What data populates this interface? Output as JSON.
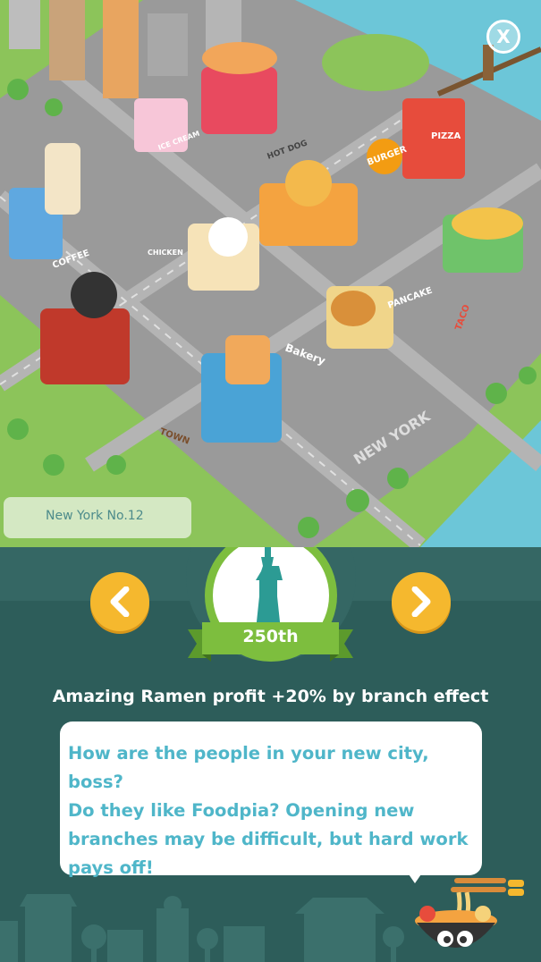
{
  "close_button": {
    "label": "X"
  },
  "city": {
    "name": "New York No.12"
  },
  "map_signs": {
    "ice_cream": "ICE CREAM",
    "hot_dog": "HOT DOG",
    "burger": "BURGER",
    "pizza": "PIZZA",
    "coffee": "COFFEE",
    "chicken": "CHICKEN",
    "taco": "TACO",
    "pancake": "PANCAKE",
    "bakery": "Bakery",
    "town": "TOWN",
    "new_york": "NEW YORK"
  },
  "landmark": {
    "icon": "statue-of-liberty-icon",
    "rank": "250th"
  },
  "navigation": {
    "prev_icon": "chevron-left-icon",
    "next_icon": "chevron-right-icon"
  },
  "effect": {
    "text": "Amazing Ramen profit +20% by branch effect"
  },
  "dialog": {
    "lines": [
      "How are the people in your new city, boss?",
      "Do they like Foodpia? Opening new",
      "branches may be difficult, but hard work",
      "pays off!"
    ]
  },
  "colors": {
    "panel": "#2d5d5a",
    "panel_light": "#356764",
    "accent_yellow": "#f5b82e",
    "ribbon_green": "#7dbe3e",
    "dialog_text": "#4fb6c9"
  }
}
